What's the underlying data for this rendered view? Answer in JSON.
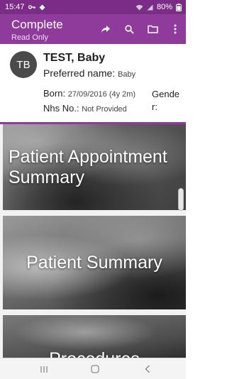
{
  "status_bar": {
    "time": "15:47",
    "battery": "80%",
    "icons": [
      "key-icon",
      "diamond-icon",
      "wifi-icon",
      "signal-icon",
      "battery-icon"
    ]
  },
  "toolbar": {
    "title": "Complete",
    "subtitle": "Read Only",
    "actions": [
      "share-icon",
      "search-icon",
      "folder-icon",
      "more-vert-icon"
    ],
    "color": "#8e3b9c"
  },
  "patient": {
    "initials": "TB",
    "name": "TEST, Baby",
    "preferred_label": "Preferred name:",
    "preferred_value": "Baby",
    "born_label": "Born:",
    "born_value": "27/09/2016 (4y 2m)",
    "nhs_label": "Nhs No.:",
    "nhs_value": "Not Provided",
    "gender_label": "Gender:"
  },
  "cards": [
    {
      "title": "Patient Appointment Summary"
    },
    {
      "title": "Patient Summary"
    },
    {
      "title": "Procedures"
    }
  ],
  "nav_bar": {
    "buttons": [
      "recents-icon",
      "home-icon",
      "back-icon"
    ]
  }
}
